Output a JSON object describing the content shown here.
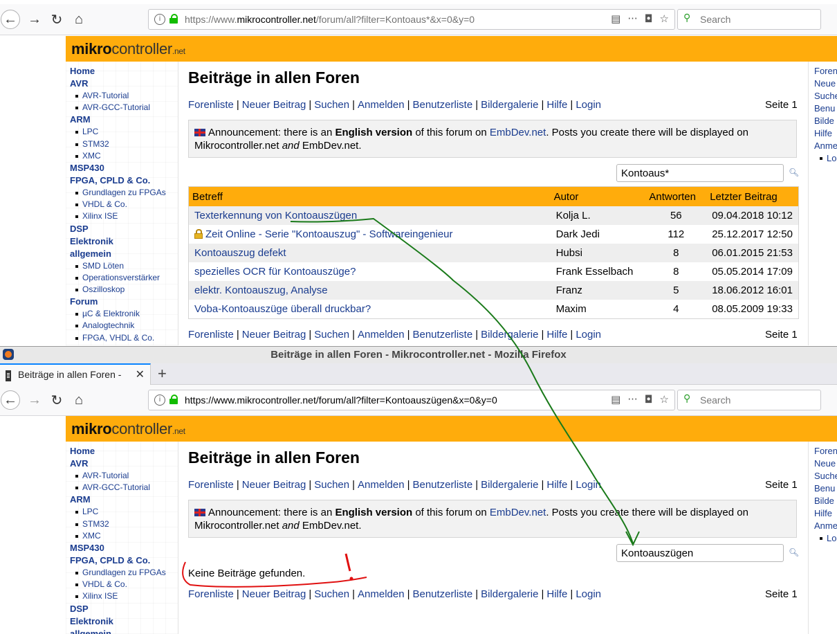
{
  "top": {
    "url_prefix": "https://www.",
    "url_domain": "mikrocontroller.net",
    "url_path": "/forum/all?filter=Kontoaus*&x=0&y=0",
    "search_placeholder": "Search",
    "forum_search_value": "Kontoaus*"
  },
  "bottom": {
    "url_prefix": "https://www.",
    "url_domain": "mikrocontroller.net",
    "url_path": "/forum/all?filter=Kontoauszügen&x=0&y=0",
    "search_placeholder": "Search",
    "forum_search_value": "Kontoauszügen",
    "no_results": "Keine Beiträge gefunden.",
    "window_title": "Beiträge in allen Foren - Mikrocontroller.net - Mozilla Firefox",
    "tab_title": "Beiträge in allen Foren -"
  },
  "site": {
    "logo_bold": "mikro",
    "logo_rest": "controller",
    "logo_tld": ".net",
    "page_title": "Beiträge in allen Foren",
    "links": [
      "Forenliste",
      "Neuer Beitrag",
      "Suchen",
      "Anmelden",
      "Benutzerliste",
      "Bildergalerie",
      "Hilfe",
      "Login"
    ],
    "page_label": "Seite 1",
    "announce": {
      "a1": "Announcement: there is an ",
      "bold": "English version",
      "a2": " of this forum on ",
      "link": "EmbDev.net",
      "a3": ". Posts you create there will be displayed on Mikrocontroller.net ",
      "em": "and",
      "a4": " EmbDev.net."
    }
  },
  "leftnav": {
    "top": [
      {
        "t": "h",
        "label": "Home"
      },
      {
        "t": "h",
        "label": "AVR"
      },
      {
        "t": "s",
        "label": "AVR-Tutorial"
      },
      {
        "t": "s",
        "label": "AVR-GCC-Tutorial"
      },
      {
        "t": "h",
        "label": "ARM"
      },
      {
        "t": "s",
        "label": "LPC"
      },
      {
        "t": "s",
        "label": "STM32"
      },
      {
        "t": "s",
        "label": "XMC"
      },
      {
        "t": "h",
        "label": "MSP430"
      },
      {
        "t": "h",
        "label": "FPGA, CPLD & Co."
      },
      {
        "t": "s",
        "label": "Grundlagen zu FPGAs"
      },
      {
        "t": "s",
        "label": "VHDL & Co."
      },
      {
        "t": "s",
        "label": "Xilinx ISE"
      },
      {
        "t": "h",
        "label": "DSP"
      },
      {
        "t": "h",
        "label": "Elektronik"
      },
      {
        "t": "h",
        "label": "allgemein"
      },
      {
        "t": "s",
        "label": "SMD Löten"
      },
      {
        "t": "s",
        "label": "Operationsverstärker"
      },
      {
        "t": "s",
        "label": "Oszilloskop"
      },
      {
        "t": "h",
        "label": "Forum"
      },
      {
        "t": "s",
        "label": "µC & Elektronik"
      },
      {
        "t": "s",
        "label": "Analogtechnik"
      },
      {
        "t": "s",
        "label": "FPGA, VHDL & Co."
      }
    ],
    "bottom": [
      {
        "t": "h",
        "label": "Home"
      },
      {
        "t": "h",
        "label": "AVR"
      },
      {
        "t": "s",
        "label": "AVR-Tutorial"
      },
      {
        "t": "s",
        "label": "AVR-GCC-Tutorial"
      },
      {
        "t": "h",
        "label": "ARM"
      },
      {
        "t": "s",
        "label": "LPC"
      },
      {
        "t": "s",
        "label": "STM32"
      },
      {
        "t": "s",
        "label": "XMC"
      },
      {
        "t": "h",
        "label": "MSP430"
      },
      {
        "t": "h",
        "label": "FPGA, CPLD & Co."
      },
      {
        "t": "s",
        "label": "Grundlagen zu FPGAs"
      },
      {
        "t": "s",
        "label": "VHDL & Co."
      },
      {
        "t": "s",
        "label": "Xilinx ISE"
      },
      {
        "t": "h",
        "label": "DSP"
      },
      {
        "t": "h",
        "label": "Elektronik"
      },
      {
        "t": "h",
        "label": "allgemein"
      }
    ]
  },
  "rightnav": {
    "top": [
      "Foren",
      "Neue",
      "Suche",
      "Benu",
      "Bilde",
      "Hilfe",
      "Anme",
      "Lo"
    ],
    "bottom": [
      "Foren",
      "Neue",
      "Suche",
      "Benu",
      "Bilde",
      "Hilfe",
      "Anme",
      "Lo"
    ]
  },
  "table": {
    "headers": [
      "Betreff",
      "Autor",
      "Antworten",
      "Letzter Beitrag"
    ],
    "rows": [
      {
        "title": "Texterkennung von Kontoauszügen",
        "author": "Kolja L.",
        "replies": "56",
        "last": "09.04.2018 10:12",
        "locked": false
      },
      {
        "title": "Zeit Online - Serie \"Kontoauszug\" - Softwareingenieur",
        "author": "Dark Jedi",
        "replies": "112",
        "last": "25.12.2017 12:50",
        "locked": true
      },
      {
        "title": "Kontoauszug defekt",
        "author": "Hubsi",
        "replies": "8",
        "last": "06.01.2015 21:53",
        "locked": false
      },
      {
        "title": "spezielles OCR für Kontoauszüge?",
        "author": "Frank Esselbach",
        "replies": "8",
        "last": "05.05.2014 17:09",
        "locked": false
      },
      {
        "title": "elektr. Kontoauszug, Analyse",
        "author": "Franz",
        "replies": "5",
        "last": "18.06.2012 16:01",
        "locked": false
      },
      {
        "title": "Voba-Kontoauszüge überall druckbar?",
        "author": "Maxim",
        "replies": "4",
        "last": "08.05.2009 19:33",
        "locked": false
      }
    ]
  },
  "annotation": {
    "red_mark": "!",
    "green_color": "#1a7a1a",
    "red_color": "#e01010"
  }
}
